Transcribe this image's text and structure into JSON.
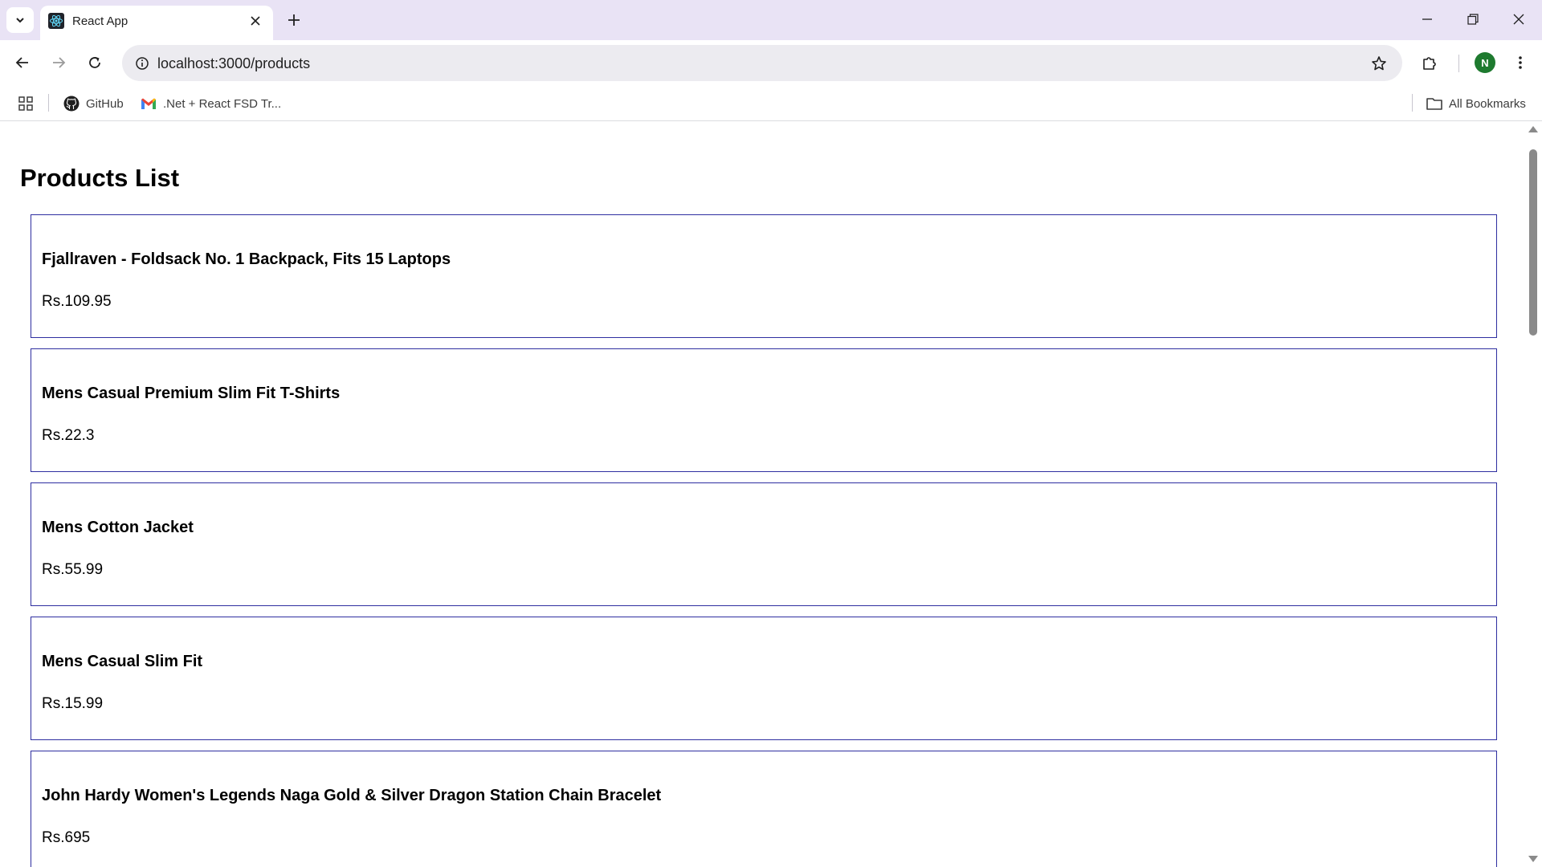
{
  "browser": {
    "tab": {
      "title": "React App",
      "favicon": "react-icon"
    },
    "address_bar": {
      "url": "localhost:3000/products"
    },
    "profile_initial": "N",
    "bookmarks": [
      {
        "label": "GitHub",
        "icon": "github-icon"
      },
      {
        "label": ".Net + React FSD Tr...",
        "icon": "gmail-icon"
      }
    ],
    "all_bookmarks_label": "All Bookmarks"
  },
  "page": {
    "title": "Products List",
    "products": [
      {
        "name": "Fjallraven - Foldsack No. 1 Backpack, Fits 15 Laptops",
        "price": "Rs.109.95"
      },
      {
        "name": "Mens Casual Premium Slim Fit T-Shirts",
        "price": "Rs.22.3"
      },
      {
        "name": "Mens Cotton Jacket",
        "price": "Rs.55.99"
      },
      {
        "name": "Mens Casual Slim Fit",
        "price": "Rs.15.99"
      },
      {
        "name": "John Hardy Women's Legends Naga Gold & Silver Dragon Station Chain Bracelet",
        "price": "Rs.695"
      }
    ]
  },
  "colors": {
    "card_border": "#2e2ea0",
    "tabstrip_bg": "#e9e3f5",
    "avatar_bg": "#1e7a2f"
  }
}
